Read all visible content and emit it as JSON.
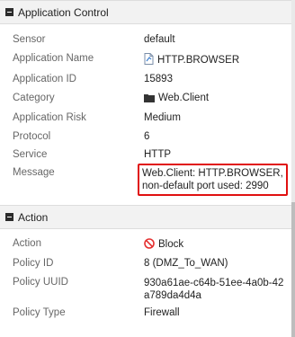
{
  "sections": [
    {
      "title": "Application Control",
      "rows": [
        {
          "label": "Sensor",
          "value": "default"
        },
        {
          "label": "Application Name",
          "value": "HTTP.BROWSER",
          "icon": "document-icon"
        },
        {
          "label": "Application ID",
          "value": "15893"
        },
        {
          "label": "Category",
          "value": "Web.Client",
          "icon": "folder-icon"
        },
        {
          "label": "Application Risk",
          "value": "Medium"
        },
        {
          "label": "Protocol",
          "value": "6"
        },
        {
          "label": "Service",
          "value": "HTTP"
        },
        {
          "label": "Message",
          "value": "Web.Client: HTTP.BROWSER, non-default port used: 2990",
          "highlight": true
        }
      ]
    },
    {
      "title": "Action",
      "rows": [
        {
          "label": "Action",
          "value": "Block",
          "icon": "block-icon"
        },
        {
          "label": "Policy ID",
          "value": "8 (DMZ_To_WAN)"
        },
        {
          "label": "Policy UUID",
          "value": "930a61ae-c64b-51ee-4a0b-42a789da4d4a"
        },
        {
          "label": "Policy Type",
          "value": "Firewall"
        }
      ]
    }
  ],
  "colors": {
    "highlight_border": "#e01010",
    "block_icon": "#e53030",
    "header_bg": "#f2f2f2"
  }
}
